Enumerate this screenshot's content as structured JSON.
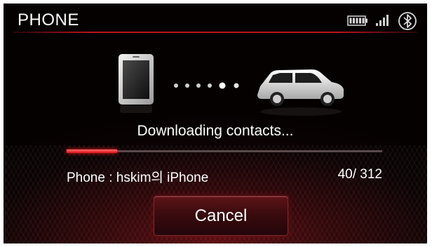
{
  "header": {
    "title": "PHONE",
    "icons": [
      "battery-icon",
      "signal-icon",
      "bluetooth-icon"
    ]
  },
  "transfer": {
    "icons": [
      "phone-icon",
      "dots-progress-icon",
      "car-icon"
    ],
    "status_text": "Downloading contacts...",
    "progress_fraction": 0.16,
    "device_label": "Phone : hskim의 iPhone",
    "count": "40/ 312"
  },
  "actions": {
    "cancel_label": "Cancel"
  },
  "colors": {
    "accent": "#e0141c",
    "background": "#0b0203",
    "text": "#ffffff"
  }
}
